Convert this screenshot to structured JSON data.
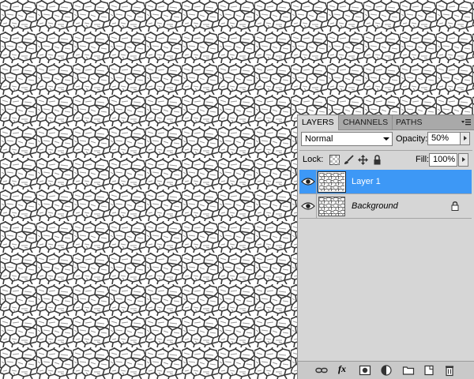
{
  "layers_panel": {
    "tabs": [
      {
        "label": "LAYERS",
        "active": true
      },
      {
        "label": "CHANNELS",
        "active": false
      },
      {
        "label": "PATHS",
        "active": false
      }
    ],
    "blend_mode": "Normal",
    "opacity_label": "Opacity:",
    "opacity_value": "50%",
    "lock_label": "Lock:",
    "fill_label": "Fill:",
    "fill_value": "100%",
    "layers": [
      {
        "name": "Layer 1",
        "selected": true,
        "visible": true,
        "locked": false
      },
      {
        "name": "Background",
        "selected": false,
        "visible": true,
        "locked": true
      }
    ],
    "footer_icons": [
      "link-layers-icon",
      "layer-style-fx-icon",
      "layer-mask-icon",
      "adjustment-layer-icon",
      "new-group-icon",
      "new-layer-icon",
      "trash-icon"
    ],
    "fx_label": "fx"
  },
  "colors": {
    "panel_bg": "#d6d6d6",
    "selection": "#3d98f6",
    "tab_bar": "#a9a9a9"
  }
}
